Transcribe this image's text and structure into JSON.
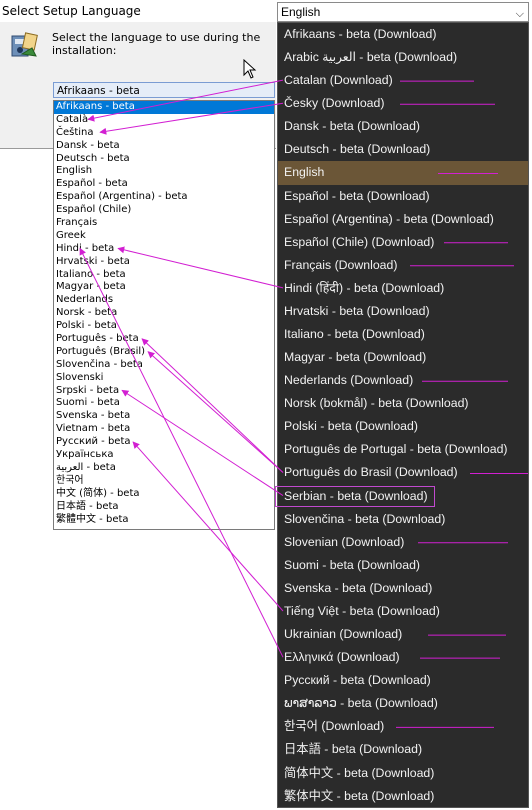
{
  "dialog": {
    "title": "Select Setup Language",
    "prompt": "Select the language to use during the installation:",
    "combo_value": "Afrikaans - beta",
    "list": [
      "Afrikaans - beta",
      "Català",
      "Čeština",
      "Dansk - beta",
      "Deutsch - beta",
      "English",
      "Español - beta",
      "Español (Argentina) - beta",
      "Español (Chile)",
      "Français",
      "Greek",
      "Hindi - beta",
      "Hrvatski - beta",
      "Italiano - beta",
      "Magyar - beta",
      "Nederlands",
      "Norsk - beta",
      "Polski - beta",
      "Português - beta",
      "Português (Brasil)",
      "Slovenčina - beta",
      "Slovenski",
      "Srpski - beta",
      "Suomi - beta",
      "Svenska - beta",
      "Vietnam - beta",
      "Русский - beta",
      "Українська",
      "العربية - beta",
      "한국어",
      "中文 (简体) - beta",
      "日本語 - beta",
      "繁體中文 - beta"
    ],
    "selected_index": 0
  },
  "dropdown": {
    "value": "English",
    "items": [
      "Afrikaans - beta (Download)",
      "Arabic العربية - beta (Download)",
      "Catalan (Download)",
      "Česky (Download)",
      "Dansk - beta (Download)",
      "Deutsch - beta (Download)",
      "English",
      "Español - beta (Download)",
      "Español (Argentina) - beta (Download)",
      "Español (Chile) (Download)",
      "Français (Download)",
      "Hindi (हिंदी) - beta (Download)",
      "Hrvatski - beta (Download)",
      "Italiano - beta (Download)",
      "Magyar - beta (Download)",
      "Nederlands (Download)",
      "Norsk (bokmål) - beta (Download)",
      "Polski - beta (Download)",
      "Português de Portugal - beta (Download)",
      "Português do Brasil (Download)",
      "Serbian - beta (Download)",
      "Slovenčina - beta (Download)",
      "Slovenian (Download)",
      "Suomi - beta (Download)",
      "Svenska - beta (Download)",
      "Tiếng Việt - beta (Download)",
      "Ukrainian (Download)",
      "Ελληνικά (Download)",
      "Русский - beta (Download)",
      "ພາສາລາວ - beta (Download)",
      "한국어 (Download)",
      "日本語 - beta (Download)",
      "简体中文 - beta (Download)",
      "繁体中文 - beta (Download)"
    ],
    "selected_index": 6,
    "boxed_index": 20
  },
  "colors": {
    "annotation": "#d21fd2",
    "dropdown_bg": "#2b2b2b",
    "dropdown_selected": "#6b5637",
    "list_selected": "#0078d7"
  }
}
